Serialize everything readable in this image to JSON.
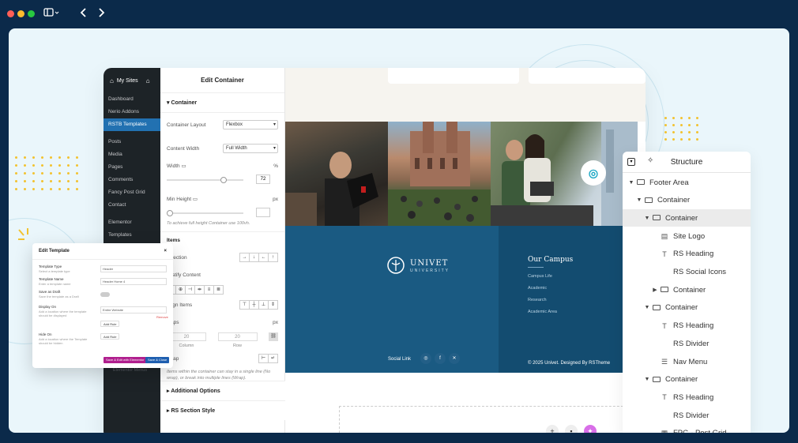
{
  "browser": {
    "icons": [
      "sidebar-toggle-icon",
      "back-icon",
      "forward-icon"
    ]
  },
  "wp_admin": {
    "site_name": "My Sites",
    "menu": [
      {
        "label": "Dashboard",
        "active": false
      },
      {
        "label": "Nerio Addons",
        "active": false
      },
      {
        "label": "RSTB Templates",
        "active": true
      },
      {
        "label": "Posts",
        "active": false
      },
      {
        "label": "Media",
        "active": false
      },
      {
        "label": "Pages",
        "active": false
      },
      {
        "label": "Comments",
        "active": false
      },
      {
        "label": "Fancy Post Grid",
        "active": false
      },
      {
        "label": "Contact",
        "active": false
      },
      {
        "label": "Elementor",
        "active": false
      },
      {
        "label": "Templates",
        "active": false
      }
    ]
  },
  "edit_container": {
    "title": "Edit Container",
    "section": "Container",
    "container_layout_label": "Container Layout",
    "container_layout_value": "Flexbox",
    "content_width_label": "Content Width",
    "content_width_value": "Full Width",
    "width_label": "Width",
    "width_unit": "%",
    "width_value": "72",
    "min_height_label": "Min Height",
    "min_height_unit": "px",
    "min_height_hint": "To achieve full height Container use 100vh.",
    "items_label": "Items",
    "direction_label": "Direction",
    "justify_label": "Justify Content",
    "align_label": "Align Items",
    "gaps_label": "Gaps",
    "gaps_unit": "px",
    "gap_column_value": "20",
    "gap_column_label": "Column",
    "gap_row_value": "20",
    "gap_row_label": "Row",
    "wrap_label": "Wrap",
    "wrap_hint": "Items within the container can stay in a single line (No wrap), or break into multiple lines (Wrap).",
    "additional_options": "Additional Options",
    "rs_section_style": "RS Section Style"
  },
  "edit_template": {
    "title": "Edit Template",
    "template_type_label": "Template Type",
    "template_type_sub": "Select a template type",
    "template_type_value": "Header",
    "template_name_label": "Template Name",
    "template_name_sub": "Enter a template name",
    "template_name_value": "Header Home 4",
    "draft_label": "Save as Draft",
    "draft_sub": "Save the template as a Draft",
    "display_on_label": "Display On",
    "display_on_sub": "Add a location where the template should be displayed",
    "display_on_value": "Entire Website",
    "remove_label": "Remove",
    "add_rule_label": "Add Rule",
    "hide_on_label": "Hide On",
    "hide_on_sub": "Add a location where the Template should be hidden",
    "add_rule_label_2": "Add Rule",
    "save_elementor_label": "Save & Edit with Elementor",
    "save_close_label": "Save & Close",
    "faded_menu_item": "Elementor Menus"
  },
  "preview": {
    "logo_text": "UNIVET",
    "logo_sub": "UNIVERSITY",
    "campus_title": "Our Campus",
    "campus_links": [
      "Campus Life",
      "Academic",
      "Research",
      "Academic Area"
    ],
    "social_label": "Social Link",
    "social_icons": [
      "instagram-icon",
      "facebook-icon",
      "x-icon"
    ],
    "copyright": "© 2025 Univet. Designed By RSTheme",
    "accent": "#1a5a82"
  },
  "structure": {
    "title": "Structure",
    "items": [
      {
        "label": "Footer Area",
        "level": 0,
        "arrow": "▼",
        "icon": "box",
        "selected": false
      },
      {
        "label": "Container",
        "level": 1,
        "arrow": "▼",
        "icon": "box",
        "selected": false
      },
      {
        "label": "Container",
        "level": 2,
        "arrow": "▼",
        "icon": "box",
        "selected": true
      },
      {
        "label": "Site Logo",
        "level": 3,
        "arrow": "",
        "icon": "▤",
        "selected": false
      },
      {
        "label": "RS Heading",
        "level": 3,
        "arrow": "",
        "icon": "T",
        "selected": false
      },
      {
        "label": "RS Social Icons",
        "level": 3,
        "arrow": "",
        "icon": "",
        "selected": false
      },
      {
        "label": "Container",
        "level": 3,
        "arrow": "▶",
        "icon": "box",
        "selected": false
      },
      {
        "label": "Container",
        "level": 2,
        "arrow": "▼",
        "icon": "box",
        "selected": false
      },
      {
        "label": "RS Heading",
        "level": 3,
        "arrow": "",
        "icon": "T",
        "selected": false
      },
      {
        "label": "RS Divider",
        "level": 3,
        "arrow": "",
        "icon": "",
        "selected": false
      },
      {
        "label": "Nav Menu",
        "level": 3,
        "arrow": "",
        "icon": "☰",
        "selected": false
      },
      {
        "label": "Container",
        "level": 2,
        "arrow": "▼",
        "icon": "box",
        "selected": false
      },
      {
        "label": "RS Heading",
        "level": 3,
        "arrow": "",
        "icon": "T",
        "selected": false
      },
      {
        "label": "RS Divider",
        "level": 3,
        "arrow": "",
        "icon": "",
        "selected": false
      },
      {
        "label": "FPG - Post Grid",
        "level": 3,
        "arrow": "",
        "icon": "▦",
        "selected": false
      }
    ]
  }
}
